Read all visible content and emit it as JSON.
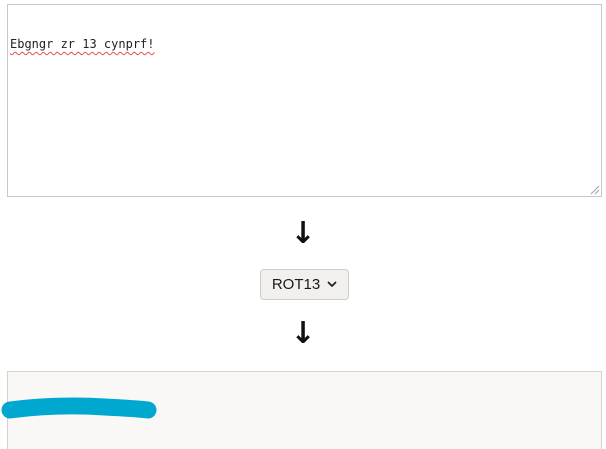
{
  "input": {
    "text": "Ebgngr zr 13 cynprf!"
  },
  "arrows": {
    "glyph": "↓"
  },
  "cipher_select": {
    "selected": "ROT13"
  },
  "output": {
    "text": ""
  },
  "colors": {
    "redaction": "#00a8d0",
    "spellcheck_underline": "#e05050"
  },
  "icons": {
    "select": "chevron-down-icon",
    "resize": "resize-grip-icon"
  }
}
